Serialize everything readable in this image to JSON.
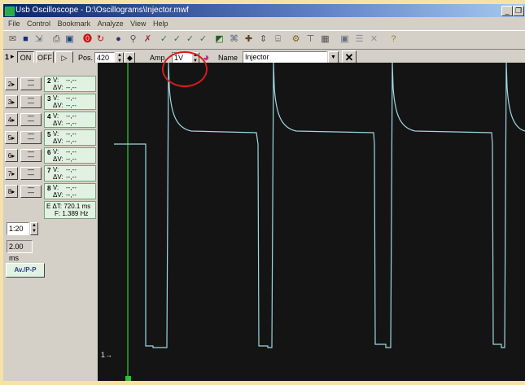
{
  "window": {
    "title": "Usb Oscilloscope - D:\\Oscillograms\\Injector.mwf"
  },
  "menu": [
    "File",
    "Control",
    "Bookmark",
    "Analyze",
    "View",
    "Help"
  ],
  "toolbar_icons": [
    "open-icon",
    "save-icon",
    "print-icon",
    "record-icon",
    "refresh-icon",
    "stop-icon",
    "zoom-icon",
    "trigger-icon",
    "measure-icon",
    "filter-icon",
    "grid-icon",
    "cursor-icon",
    "help-icon"
  ],
  "ch1": {
    "label": "1",
    "on_label": "ON",
    "off_label": "OFF",
    "pos_label": "Pos.",
    "pos_value": "420",
    "amp_label": "Amp.",
    "amp_value": "1V",
    "name_label": "Name",
    "name_value": "Injector"
  },
  "channels": [
    {
      "num": "2",
      "v": "V:",
      "dv": "ΔV:",
      "val1": "--,--",
      "val2": "--,--"
    },
    {
      "num": "3",
      "v": "V:",
      "dv": "ΔV:",
      "val1": "--,--",
      "val2": "--,--"
    },
    {
      "num": "4",
      "v": "V:",
      "dv": "ΔV:",
      "val1": "--,--",
      "val2": "--,--"
    },
    {
      "num": "5",
      "v": "V:",
      "dv": "ΔV:",
      "val1": "--,--",
      "val2": "--,--"
    },
    {
      "num": "6",
      "v": "V:",
      "dv": "ΔV:",
      "val1": "--,--",
      "val2": "--,--"
    },
    {
      "num": "7",
      "v": "V:",
      "dv": "ΔV:",
      "val1": "--,--",
      "val2": "--,--"
    },
    {
      "num": "8",
      "v": "V:",
      "dv": "ΔV:",
      "val1": "--,--",
      "val2": "--,--"
    }
  ],
  "measure": {
    "dt": "E ΔT: 720.1 ms",
    "freq": "F: 1.389 Hz"
  },
  "timebase": {
    "ratio": "1:20",
    "scale": "2.00 ms"
  },
  "avpp_label": "Av./P-P",
  "marker_label": "1→",
  "colors": {
    "trace": "#9fd8e0",
    "cursor": "#2fc03a",
    "screen": "#141414",
    "highlight": "#d31c1c"
  }
}
